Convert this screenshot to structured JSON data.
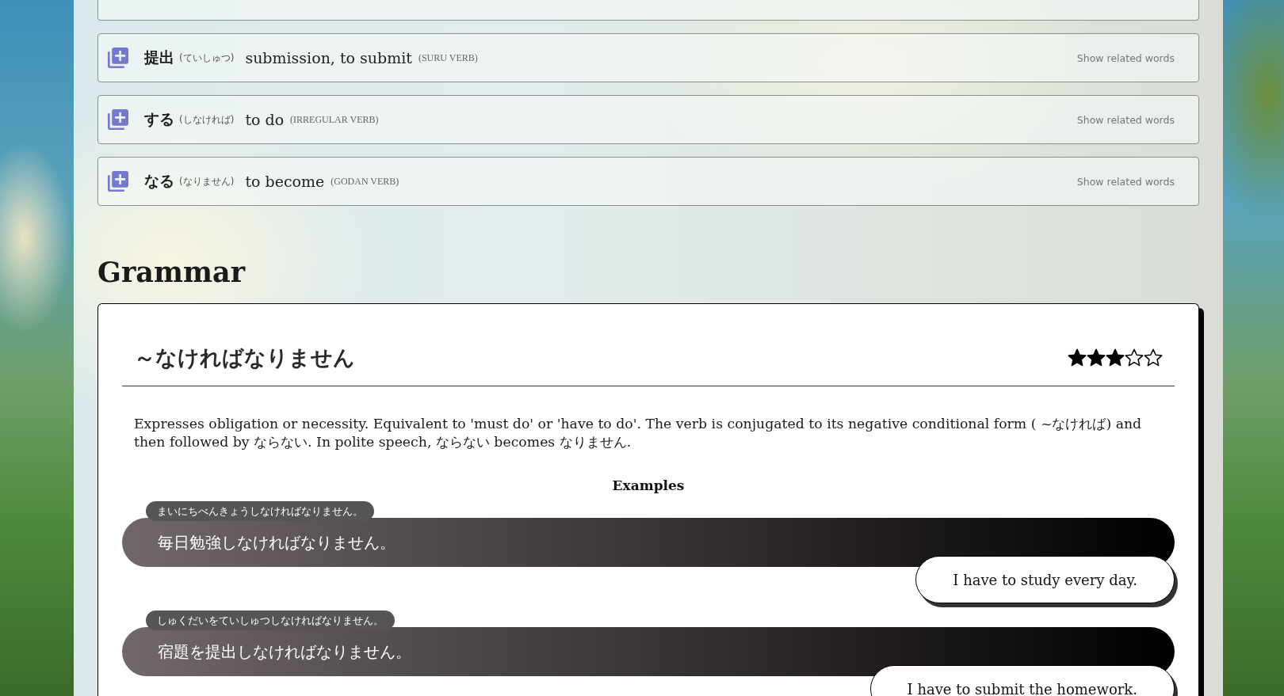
{
  "vocabulary": [
    {
      "word": "提出",
      "reading": "(ていしゅつ)",
      "meaning": "submission, to submit",
      "part_of_speech": "(SURU VERB)",
      "action": "Show related words"
    },
    {
      "word": "する",
      "reading": "(しなければ)",
      "meaning": "to do",
      "part_of_speech": "(IRREGULAR VERB)",
      "action": "Show related words"
    },
    {
      "word": "なる",
      "reading": "(なりません)",
      "meaning": "to become",
      "part_of_speech": "(GODAN VERB)",
      "action": "Show related words"
    }
  ],
  "grammar": {
    "heading": "Grammar",
    "title": "～なければなりません",
    "stars": 3,
    "description": "Expresses obligation or necessity. Equivalent to 'must do' or 'have to do'. The verb is conjugated to its negative conditional form ( ~なければ) and then followed by ならない. In polite speech, ならない becomes なりません.",
    "examples_heading": "Examples",
    "examples": [
      {
        "furigana": "まいにちべんきょうしなければなりません。",
        "sentence": "毎日勉強しなければなりません。",
        "translation": "I have to study every day."
      },
      {
        "furigana": "しゅくだいをていしゅつしなければなりません。",
        "sentence": "宿題を提出しなければなりません。",
        "translation": "I have to submit the homework."
      }
    ]
  }
}
